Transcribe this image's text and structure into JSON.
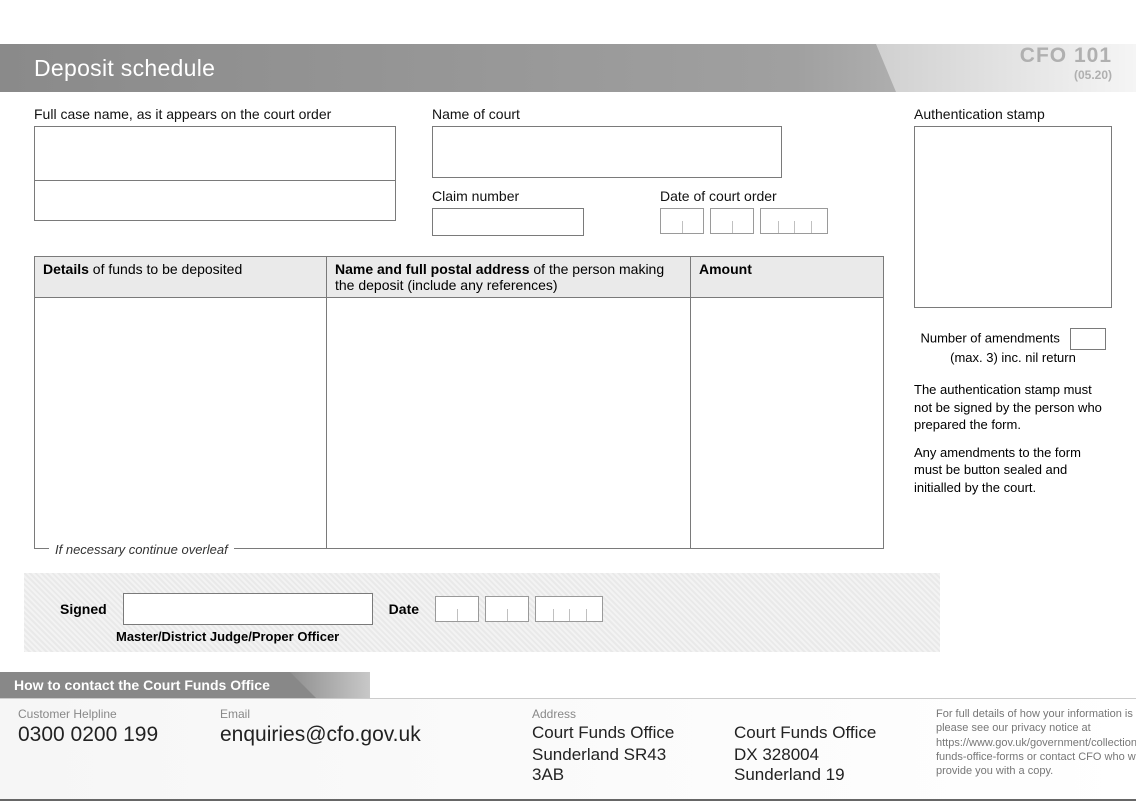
{
  "header": {
    "title": "Deposit schedule",
    "form_code": "CFO 101",
    "revision": "(05.20)"
  },
  "fields": {
    "case_name_label": "Full case name, as it appears on the court order",
    "court_label": "Name of court",
    "claim_label": "Claim number",
    "date_order_label": "Date of court order"
  },
  "table": {
    "col1_bold": "Details",
    "col1_rest": " of funds to be deposited",
    "col2_bold": "Name and full postal address",
    "col2_rest": " of the person making the deposit (include any references)",
    "col3_bold": "Amount",
    "overleaf": "If necessary continue overleaf"
  },
  "auth": {
    "label": "Authentication stamp",
    "amend_line1": "Number of amendments",
    "amend_line2": "(max. 3) inc. nil return",
    "note1": "The authentication stamp must not be signed by the person who prepared the form.",
    "note2": "Any amendments to the form must be button sealed and initialled by the court."
  },
  "sign": {
    "signed_label": "Signed",
    "date_label": "Date",
    "subtitle": "Master/District Judge/Proper Officer"
  },
  "contact": {
    "heading": "How to contact the Court Funds Office",
    "helpline_label": "Customer Helpline",
    "helpline_value": "0300 0200 199",
    "email_label": "Email",
    "email_value": "enquiries@cfo.gov.uk",
    "address_label": "Address",
    "address_line1": "Court Funds Office",
    "address_line2": "Sunderland  SR43 3AB",
    "dx_line1": "Court Funds Office",
    "dx_line2": "DX 328004 Sunderland 19",
    "privacy": "For full details of how your information is used please see our privacy notice at https://www.gov.uk/government/collections/court-funds-office-forms or contact CFO who will provide you with a copy."
  }
}
